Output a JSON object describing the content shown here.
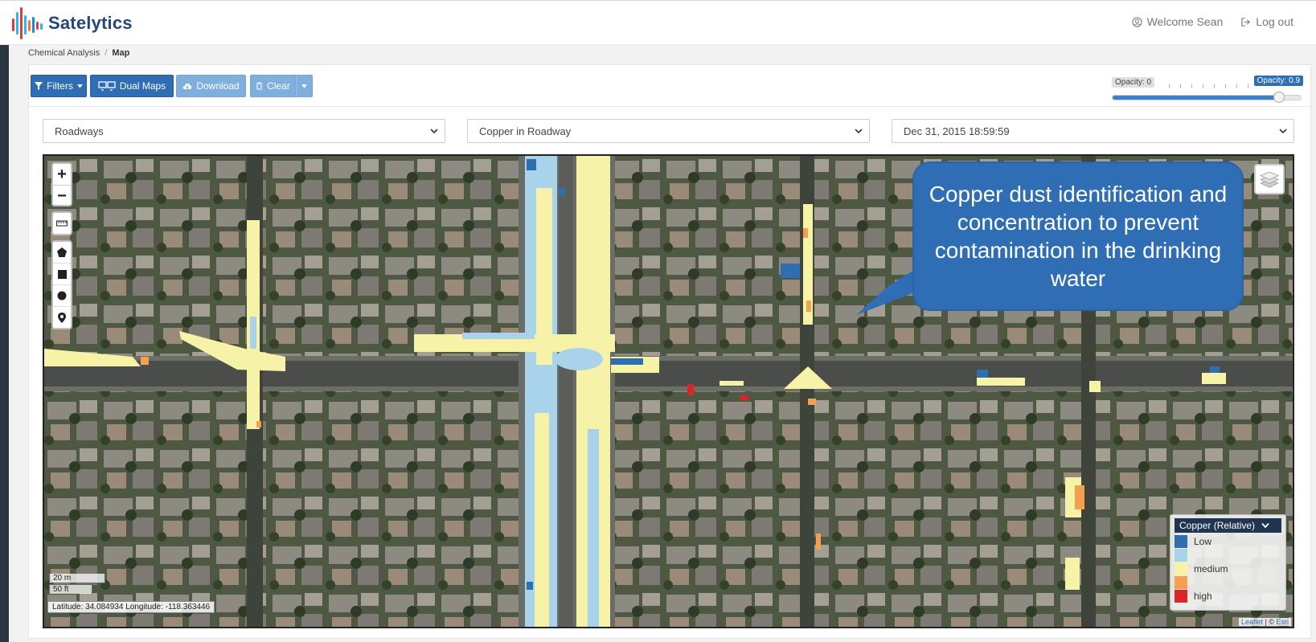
{
  "app": {
    "name": "Satelytics"
  },
  "header": {
    "welcome": "Welcome Sean",
    "logout": "Log out"
  },
  "breadcrumb": {
    "parent": "Chemical Analysis",
    "separator": "/",
    "current": "Map"
  },
  "toolbar": {
    "filters": "Filters",
    "dual_maps": "Dual Maps",
    "download": "Download",
    "clear": "Clear"
  },
  "opacity": {
    "min_label": "Opacity: 0",
    "current_label": "Opacity: 0.9",
    "value": 0.9
  },
  "selectors": {
    "layer": "Roadways",
    "analysis": "Copper in Roadway",
    "date": "Dec 31, 2015 18:59:59"
  },
  "map": {
    "callout": "Copper dust identification and concentration to prevent contamination in the drinking water",
    "scale_metric": "20 m",
    "scale_imperial": "50 ft",
    "coordinates": "Latitude: 34.084934 Longitude: -118.363446",
    "attribution_leaflet": "Leaflet",
    "attribution_sep": "| ©",
    "attribution_esri": "Esri",
    "zoom_in": "+",
    "zoom_out": "−"
  },
  "legend": {
    "title": "Copper (Relative)",
    "items": [
      {
        "label": "Low",
        "color": "#2e6fb0"
      },
      {
        "label": "",
        "color": "#a8d3ea"
      },
      {
        "label": "medium",
        "color": "#f6f2a8"
      },
      {
        "label": "",
        "color": "#f5a04f"
      },
      {
        "label": "high",
        "color": "#d8262a"
      }
    ]
  },
  "colors": {
    "brand": "#24477a",
    "primary_button": "#2f6db5",
    "disabled_button": "#7fb0dd",
    "callout": "#2f6db5"
  }
}
